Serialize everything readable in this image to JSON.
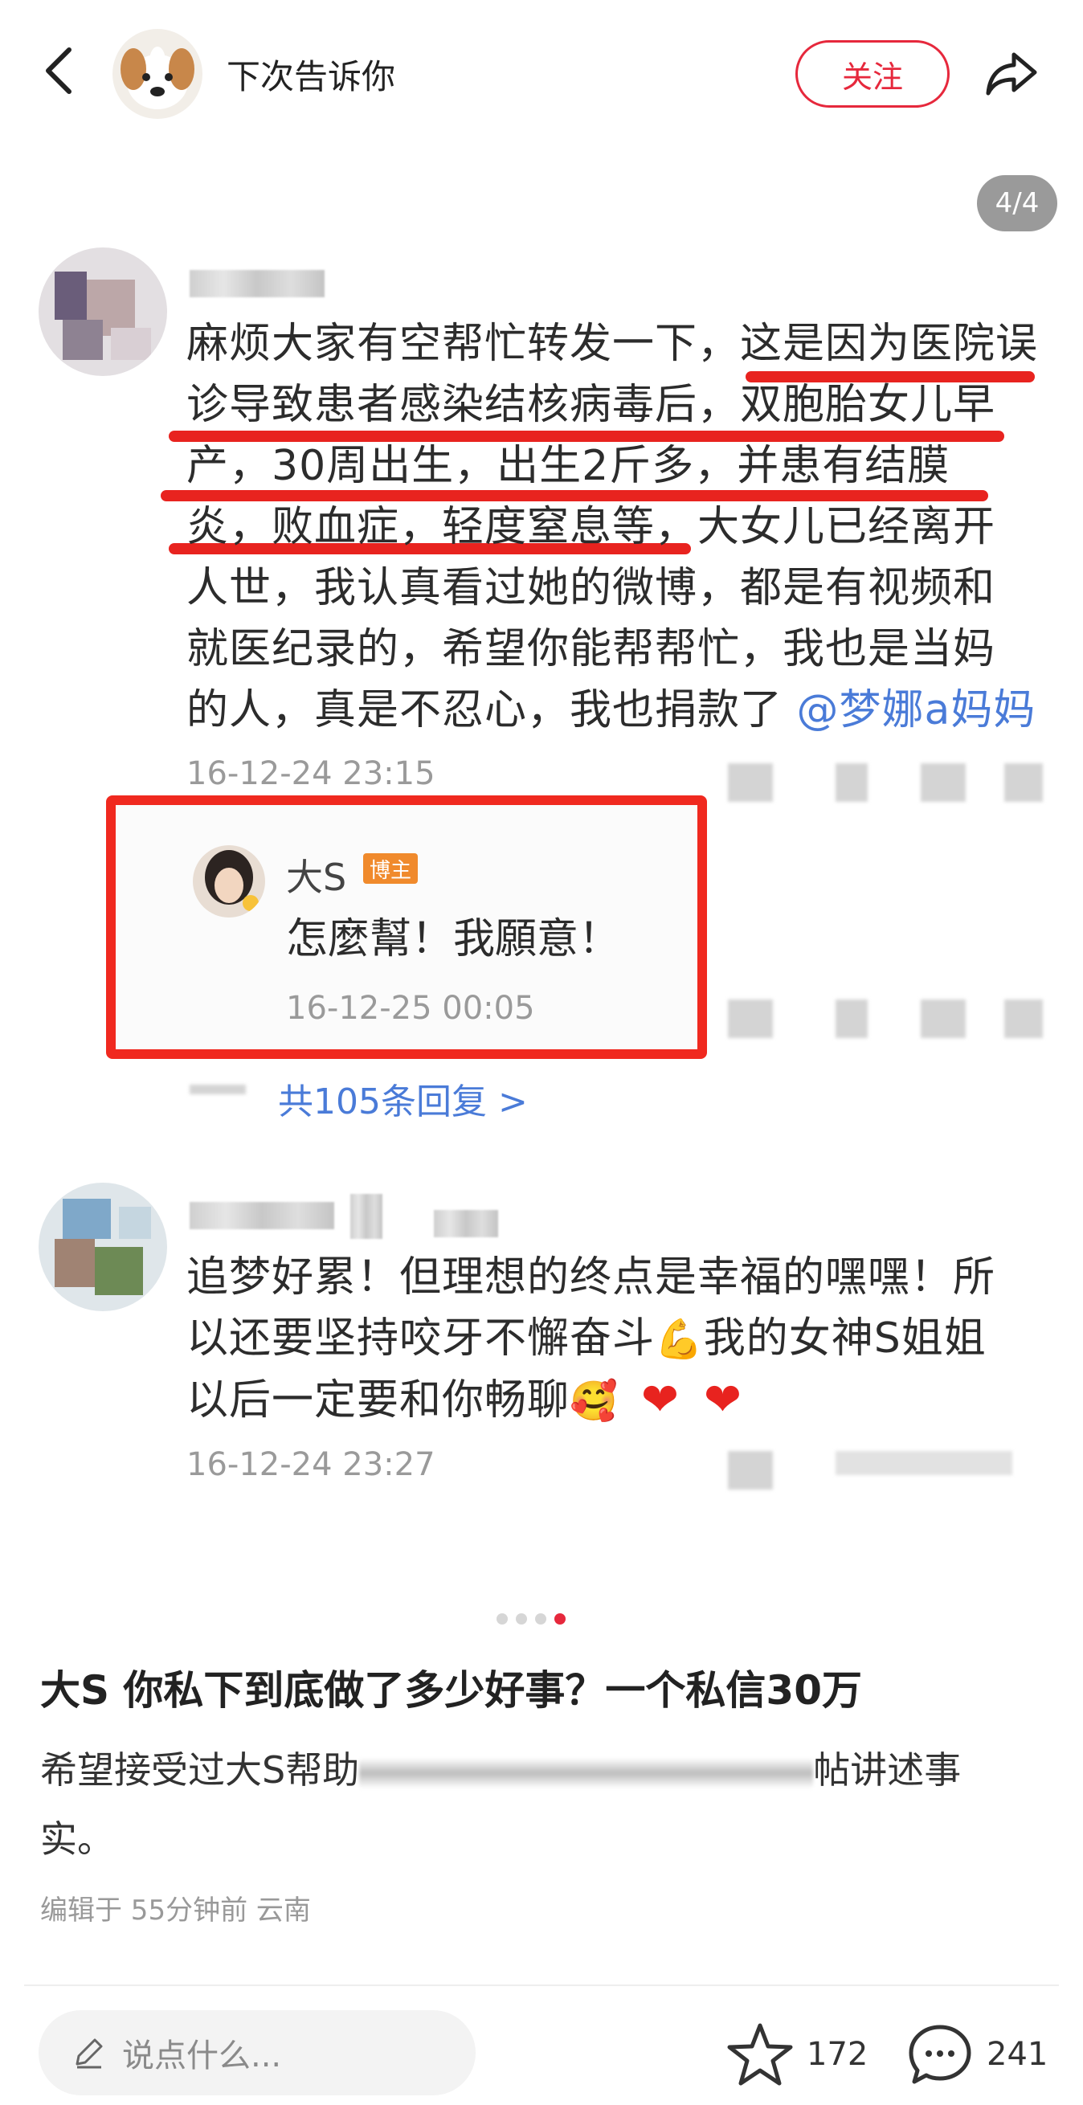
{
  "header": {
    "username": "下次告诉你",
    "follow_label": "关注"
  },
  "image": {
    "page_counter": "4/4",
    "comment1": {
      "lines": [
        "麻烦大家有空帮忙转发一下，这是因为医院误",
        "诊导致患者感染结核病毒后，双胞胎女儿早",
        "产，30周出生，出生2斤多，并患有结膜",
        "炎，败血症，轻度窒息等，大女儿已经离开",
        "人世，我认真看过她的微博，都是有视频和",
        "就医纪录的，希望你能帮帮忙，我也是当妈",
        "的人，真是不忍心，我也捐款了"
      ],
      "mention": "@梦娜a妈妈",
      "date": "16-12-24 23:15"
    },
    "reply": {
      "name": "大S",
      "badge": "博主",
      "text": "怎麼幫！我願意！",
      "date": "16-12-25 00:05"
    },
    "replies_link": "共105条回复 >",
    "comment2": {
      "lines": [
        "追梦好累！但理想的终点是幸福的嘿嘿！所",
        "以还要坚持咬牙不懈奋斗",
        "以后一定要和你畅聊"
      ],
      "line2_suffix": "我的女神S姐姐",
      "date": "16-12-24 23:27"
    }
  },
  "post": {
    "title": "大S 你私下到底做了多少好事？一个私信30万",
    "body_start": "希望接受过大S帮助",
    "body_end": "帖讲述事",
    "body_line2": "实。",
    "meta": "编辑于 55分钟前 云南"
  },
  "bottom_bar": {
    "comment_placeholder": "说点什么...",
    "favorite_count": "172",
    "comment_count": "241"
  },
  "colors": {
    "accent": "#e6283c",
    "highlight_red": "#f0291f",
    "link_blue": "#4a7bd8"
  }
}
